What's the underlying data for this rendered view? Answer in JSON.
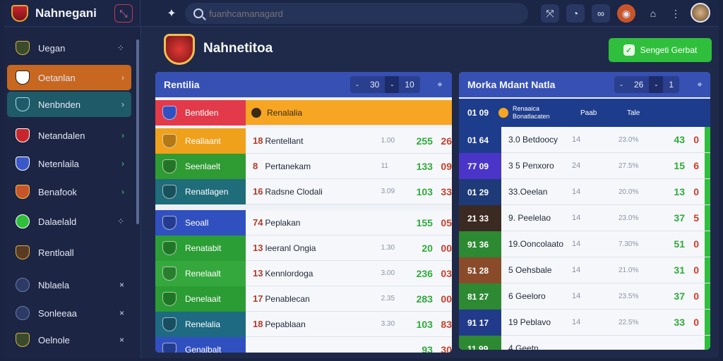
{
  "brand": {
    "name": "Nahnegani"
  },
  "search": {
    "placeholder": "fuanhcamanagard"
  },
  "page": {
    "title": "Nahnetitoa",
    "action_button": "Sengeti Gerbat"
  },
  "sidebar": {
    "items": [
      {
        "label": "Uegan",
        "chevron": "⁘",
        "state": "normal"
      },
      {
        "label": "Oetanlan",
        "chevron": "›",
        "state": "orange"
      },
      {
        "label": "Nenbnden",
        "chevron": "›",
        "state": "teal"
      },
      {
        "label": "Netandalen",
        "chevron": "›",
        "state": "green"
      },
      {
        "label": "Netenlaila",
        "chevron": "›",
        "state": "green"
      },
      {
        "label": "Benafook",
        "chevron": "›",
        "state": "green"
      },
      {
        "label": "Dalaelald",
        "chevron": "⁘",
        "state": "normal"
      },
      {
        "label": "Rentloall",
        "chevron": "",
        "state": "normal"
      },
      {
        "label": "Nblaela",
        "chevron": "×",
        "state": "normal"
      },
      {
        "label": "Sonleeaa",
        "chevron": "×",
        "state": "normal"
      },
      {
        "label": "Oelnole",
        "chevron": "×",
        "state": "normal"
      }
    ]
  },
  "left_panel": {
    "title": "Rentilia",
    "controls": {
      "a": "-",
      "b": "30",
      "c": "-",
      "d": "10"
    },
    "header_row": {
      "team": "Bentlden",
      "player": "Renalalia"
    },
    "rows": [
      {
        "team": "Reallaant",
        "num": "18",
        "name": "Rentellant",
        "odds": "1.00",
        "s1": "255",
        "s2": "26",
        "color": "#f0a11b"
      },
      {
        "team": "Seenlaelt",
        "num": "8",
        "name": "Pertanekam",
        "odds": "11",
        "s1": "133",
        "s2": "09",
        "color": "#2f9b33"
      },
      {
        "team": "Renatlagen",
        "num": "16",
        "name": "Radsne Clodali",
        "odds": "3.09",
        "s1": "103",
        "s2": "33",
        "color": "#1f6c7a"
      },
      {
        "team": "Seoall",
        "num": "74",
        "name": "Peplakan",
        "odds": "",
        "s1": "155",
        "s2": "05",
        "color": "#3150c0"
      },
      {
        "team": "Renatabit",
        "num": "13",
        "name": "Ieeranl Ongia",
        "odds": "1.30",
        "s1": "20",
        "s2": "00",
        "color": "#2b9e35"
      },
      {
        "team": "Renelaalt",
        "num": "13",
        "name": "Kennlordoga",
        "odds": "3.00",
        "s1": "236",
        "s2": "03",
        "color": "#35a83d"
      },
      {
        "team": "Denelaait",
        "num": "17",
        "name": "Penablecan",
        "odds": "2.35",
        "s1": "283",
        "s2": "00",
        "color": "#2a9c33"
      },
      {
        "team": "Renelalia",
        "num": "18",
        "name": "Pepablaan",
        "odds": "3.30",
        "s1": "103",
        "s2": "83",
        "color": "#1d6a82"
      },
      {
        "team": "Genalbalt",
        "num": "",
        "name": "",
        "odds": "",
        "s1": "93",
        "s2": "30",
        "color": "#3150c0"
      }
    ]
  },
  "right_panel": {
    "title": "Morka Mdant Natla",
    "controls": {
      "a": "-",
      "b": "26",
      "c": "-",
      "d": "1"
    },
    "header_row": {
      "rank": "01 09",
      "team": "Renaaica",
      "sub": "Bonatlacaten",
      "c1": "Paab",
      "c2": "Tale"
    },
    "rows": [
      {
        "rank": "01 64",
        "team": "3.0 Betdoocy",
        "p": "14",
        "pct": "23.0%",
        "w": "43",
        "l": "0",
        "bg": "#1e3c8c"
      },
      {
        "rank": "77 09",
        "team": "3 5 Penxoro",
        "p": "24",
        "pct": "27.5%",
        "w": "15",
        "l": "6",
        "bg": "#4b35c8"
      },
      {
        "rank": "01 29",
        "team": "33.Oeelan",
        "p": "14",
        "pct": "20.0%",
        "w": "13",
        "l": "0",
        "bg": "#1e3a78"
      },
      {
        "rank": "21 33",
        "team": "9. Peelelao",
        "p": "14",
        "pct": "23.0%",
        "w": "37",
        "l": "5",
        "bg": "#3b2a22"
      },
      {
        "rank": "91 36",
        "team": "19.Ooncolaato",
        "p": "14",
        "pct": "7.30%",
        "w": "51",
        "l": "0",
        "bg": "#2d8a32"
      },
      {
        "rank": "51 28",
        "team": "5 Oehsbale",
        "p": "14",
        "pct": "21.0%",
        "w": "31",
        "l": "0",
        "bg": "#8a4b2a"
      },
      {
        "rank": "81 27",
        "team": "6 Geeloro",
        "p": "14",
        "pct": "23.5%",
        "w": "37",
        "l": "0",
        "bg": "#2d8a32"
      },
      {
        "rank": "91 17",
        "team": "19 Peblavo",
        "p": "14",
        "pct": "22.5%",
        "w": "33",
        "l": "0",
        "bg": "#223a8a"
      },
      {
        "rank": "11 99",
        "team": "4 Geetn",
        "p": "",
        "pct": "",
        "w": "",
        "l": "",
        "bg": "#2d8a32"
      }
    ]
  }
}
